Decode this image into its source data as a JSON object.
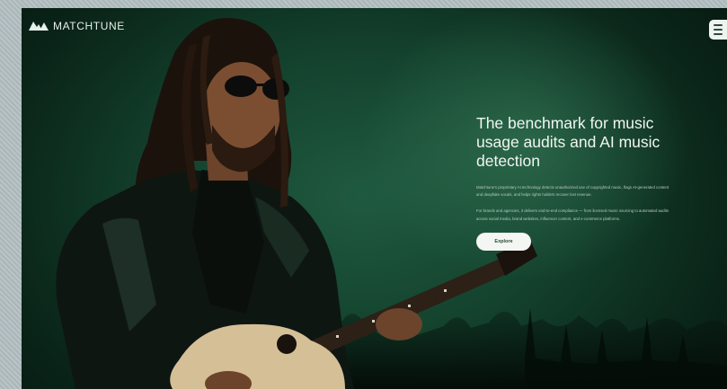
{
  "brand": {
    "name": "MATCHTUNE",
    "icon": "matchtune-logo-icon"
  },
  "nav": {
    "menu_icon": "hamburger-menu-icon"
  },
  "hero": {
    "headline": "The benchmark for music usage audits and AI music detection",
    "paragraph_1": "Matchtune's proprietary AI technology detects unauthorized use of copyrighted music, flags AI-generated content and deepfake vocals, and helps rights holders recover lost revenue.",
    "paragraph_2": "For brands and agencies, it delivers end-to-end compliance — from licensed music sourcing to automated audits across social media, brand websites, influencer content, and e-commerce platforms.",
    "cta_label": "Explore"
  },
  "colors": {
    "background": "#0f3a28",
    "accent_glow": "#3c825f",
    "text_primary": "#f1f6f2",
    "button_bg": "#f3f6f3"
  }
}
